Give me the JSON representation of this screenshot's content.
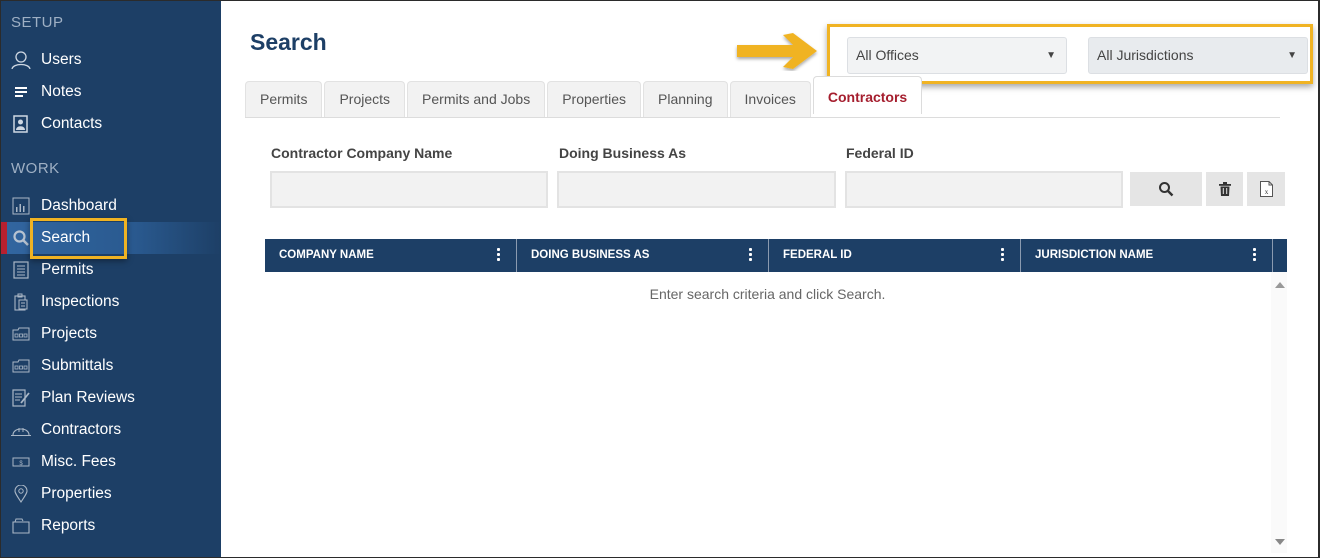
{
  "sidebar": {
    "setup_label": "SETUP",
    "work_label": "WORK",
    "setup_items": [
      {
        "label": "Users",
        "icon": "user-icon"
      },
      {
        "label": "Notes",
        "icon": "notes-icon"
      },
      {
        "label": "Contacts",
        "icon": "contacts-icon"
      }
    ],
    "work_items": [
      {
        "label": "Dashboard",
        "icon": "dashboard-icon"
      },
      {
        "label": "Search",
        "icon": "search-icon",
        "active": true
      },
      {
        "label": "Permits",
        "icon": "permits-icon"
      },
      {
        "label": "Inspections",
        "icon": "inspections-icon"
      },
      {
        "label": "Projects",
        "icon": "projects-icon"
      },
      {
        "label": "Submittals",
        "icon": "submittals-icon"
      },
      {
        "label": "Plan Reviews",
        "icon": "plan-reviews-icon"
      },
      {
        "label": "Contractors",
        "icon": "hard-hat-icon"
      },
      {
        "label": "Misc. Fees",
        "icon": "money-icon"
      },
      {
        "label": "Properties",
        "icon": "map-pin-icon"
      },
      {
        "label": "Reports",
        "icon": "folder-icon"
      }
    ]
  },
  "header": {
    "title": "Search",
    "offices_select": "All Offices",
    "jurisdictions_select": "All Jurisdictions"
  },
  "tabs": [
    {
      "label": "Permits"
    },
    {
      "label": "Projects"
    },
    {
      "label": "Permits and Jobs"
    },
    {
      "label": "Properties"
    },
    {
      "label": "Planning"
    },
    {
      "label": "Invoices"
    },
    {
      "label": "Contractors",
      "active": true
    }
  ],
  "form": {
    "company_name_label": "Contractor Company Name",
    "company_name_value": "",
    "dba_label": "Doing Business As",
    "dba_value": "",
    "federal_id_label": "Federal ID",
    "federal_id_value": ""
  },
  "grid": {
    "columns": [
      "COMPANY NAME",
      "DOING BUSINESS AS",
      "FEDERAL ID",
      "JURISDICTION NAME"
    ],
    "empty_message": "Enter search criteria and click Search."
  },
  "colors": {
    "sidebar_bg": "#1d3f66",
    "active_accent": "#b8202f",
    "highlight": "#f0b323",
    "active_tab_text": "#a51e2e"
  }
}
